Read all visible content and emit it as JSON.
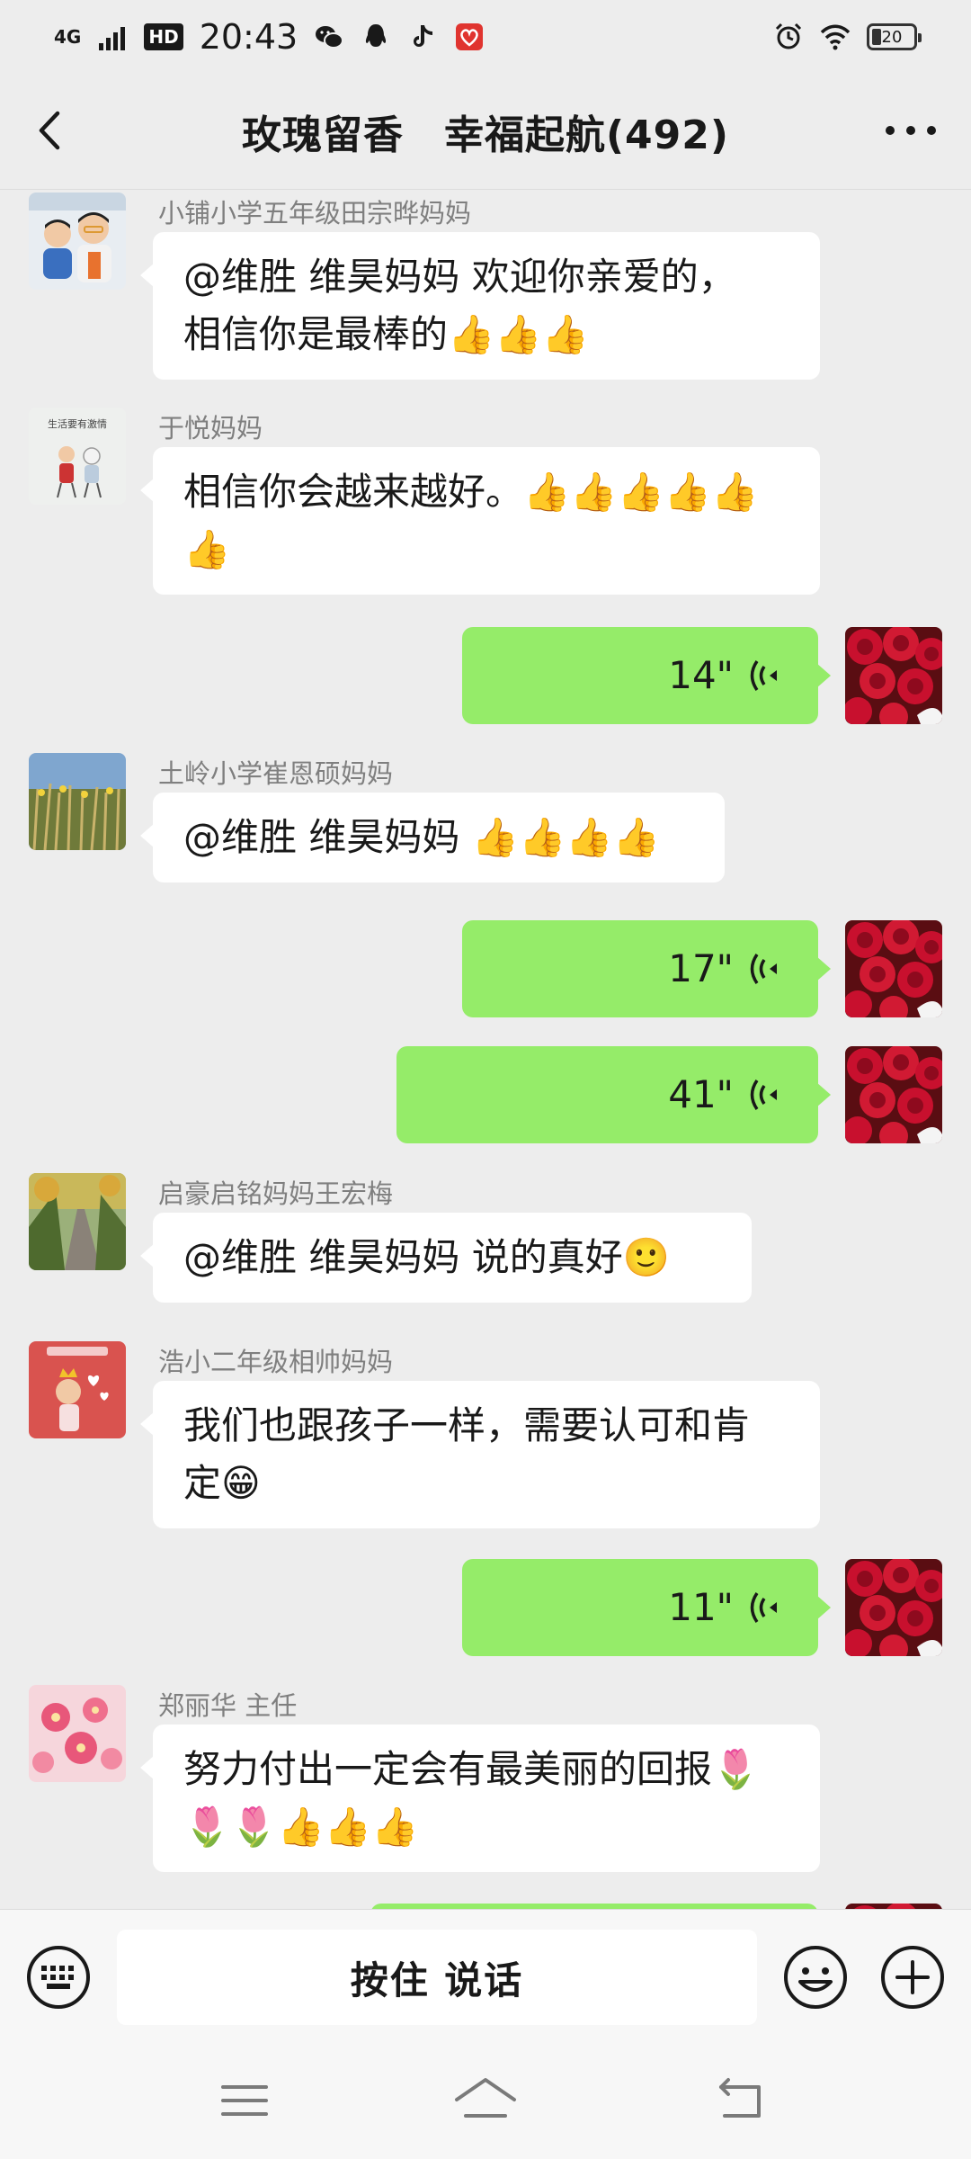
{
  "status_bar": {
    "network": "4G",
    "hd": "HD",
    "time": "20:43",
    "icons": [
      "wechat-icon",
      "qq-icon",
      "tiktok-icon",
      "app-icon"
    ],
    "right_icons": [
      "alarm-icon",
      "wifi-icon"
    ],
    "battery": "20"
  },
  "header": {
    "title": "玫瑰留香　幸福起航(492)",
    "back_icon": "chevron-left-icon",
    "more_icon": "more-dots-icon"
  },
  "messages": [
    {
      "type": "text",
      "side": "left",
      "sender": "小铺小学五年级田宗晔妈妈",
      "lines": [
        "@维胜  维昊妈妈  欢迎你亲爱的，",
        "相信你是最棒的👍👍👍"
      ]
    },
    {
      "type": "text",
      "side": "left",
      "sender": "于悦妈妈",
      "lines": [
        "相信你会越来越好。👍👍👍👍👍",
        "👍"
      ]
    },
    {
      "type": "voice",
      "side": "right",
      "duration": "14\""
    },
    {
      "type": "text",
      "side": "left",
      "sender": "土岭小学崔恩硕妈妈",
      "lines": [
        "@维胜  维昊妈妈  👍👍👍👍"
      ]
    },
    {
      "type": "voice",
      "side": "right",
      "duration": "17\""
    },
    {
      "type": "voice",
      "side": "right",
      "duration": "41\""
    },
    {
      "type": "text",
      "side": "left",
      "sender": "启豪启铭妈妈王宏梅",
      "lines": [
        "@维胜  维昊妈妈  说的真好🙂"
      ]
    },
    {
      "type": "text",
      "side": "left",
      "sender": "浩小二年级相帅妈妈",
      "lines": [
        "我们也跟孩子一样，需要认可和肯",
        "定😁"
      ]
    },
    {
      "type": "voice",
      "side": "right",
      "duration": "11\""
    },
    {
      "type": "text",
      "side": "left",
      "sender": "郑丽华  主任",
      "lines": [
        "努力付出一定会有最美丽的回报🌷",
        "🌷🌷👍👍👍"
      ]
    }
  ],
  "input_bar": {
    "hold_to_talk": "按住  说话",
    "keyboard_icon": "keyboard-icon",
    "emoji_icon": "smiley-icon",
    "plus_icon": "plus-circle-icon"
  },
  "nav_bar": {
    "icons": [
      "menu-icon",
      "home-icon",
      "back-icon"
    ]
  },
  "colors": {
    "background": "#ededed",
    "voice_bubble": "#95ec69",
    "text_bubble": "#ffffff",
    "sender_text": "#7f7f7f"
  }
}
